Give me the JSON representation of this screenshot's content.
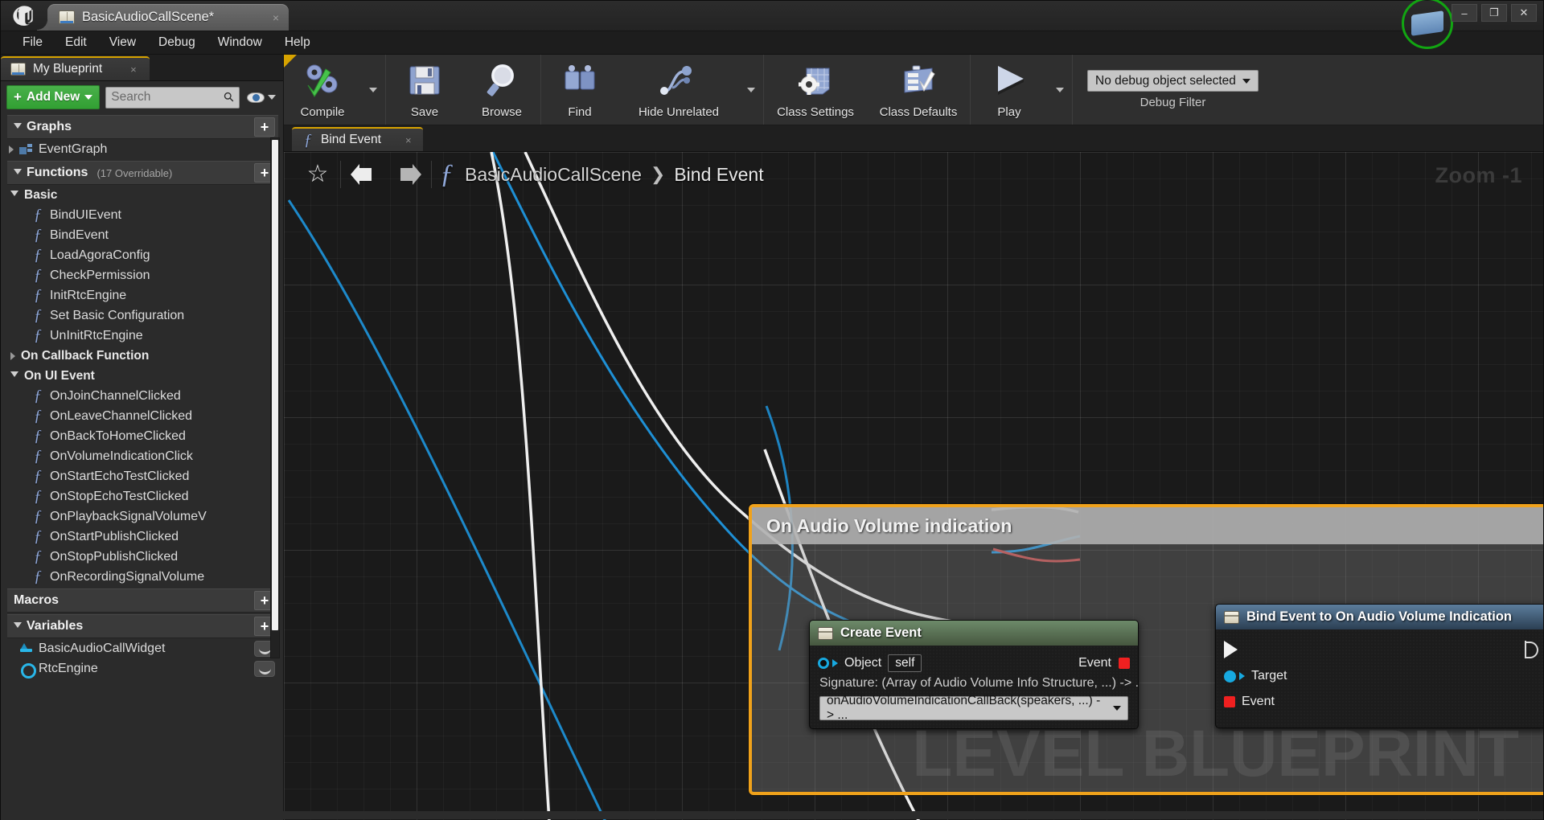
{
  "window": {
    "logo": "unreal-engine-logo",
    "document_tab": "BasicAudioCallScene*",
    "minimize": "–",
    "maximize": "❐",
    "close": "✕",
    "tab_close": "×"
  },
  "menubar": [
    "File",
    "Edit",
    "View",
    "Debug",
    "Window",
    "Help"
  ],
  "my_blueprint": {
    "tab_label": "My Blueprint",
    "tab_close": "×",
    "add_new_label": "Add New",
    "add_new_plus": "+",
    "search_placeholder": "Search",
    "sections": [
      {
        "name": "Graphs",
        "sub": "",
        "add": "+",
        "items": [
          {
            "label": "EventGraph",
            "icon": "event-graph-icon",
            "expandable": true
          }
        ]
      },
      {
        "name": "Functions",
        "sub": "(17 Overridable)",
        "add": "+",
        "categories": [
          {
            "label": "Basic",
            "expanded": true,
            "functions": [
              "BindUIEvent",
              "BindEvent",
              "LoadAgoraConfig",
              "CheckPermission",
              "InitRtcEngine",
              "Set Basic Configuration",
              "UnInitRtcEngine"
            ]
          },
          {
            "label": "On Callback Function",
            "expanded": false,
            "functions": []
          },
          {
            "label": "On UI Event",
            "expanded": true,
            "functions": [
              "OnJoinChannelClicked",
              "OnLeaveChannelClicked",
              "OnBackToHomeClicked",
              "OnVolumeIndicationClick",
              "OnStartEchoTestClicked",
              "OnStopEchoTestClicked",
              "OnPlaybackSignalVolumeV",
              "OnStartPublishClicked",
              "OnStopPublishClicked",
              "OnRecordingSignalVolume"
            ]
          }
        ]
      },
      {
        "name": "Macros",
        "sub": "",
        "add": "+",
        "items": []
      },
      {
        "name": "Variables",
        "sub": "",
        "add": "+",
        "items": [
          {
            "label": "BasicAudioCallWidget",
            "icon": "widget-variable-icon"
          },
          {
            "label": "RtcEngine",
            "icon": "object-variable-icon"
          }
        ]
      }
    ]
  },
  "toolbar": {
    "compile": "Compile",
    "save": "Save",
    "browse": "Browse",
    "find": "Find",
    "hide_unrelated": "Hide Unrelated",
    "class_settings": "Class Settings",
    "class_defaults": "Class Defaults",
    "play": "Play",
    "debug_object": "No debug object selected",
    "debug_filter_label": "Debug Filter"
  },
  "graph_tab": {
    "label": "Bind Event",
    "close": "×"
  },
  "breadcrumb": {
    "star": "☆",
    "back": "back-arrow",
    "forward": "forward-arrow",
    "fx": "ƒ",
    "root": "BasicAudioCallScene",
    "chevron": "❯",
    "current": "Bind Event"
  },
  "canvas": {
    "zoom_label": "Zoom -1",
    "watermark": "LEVEL BLUEPRINT"
  },
  "comment_node": {
    "title": "On Audio Volume indication",
    "border_color": "#f0a21b"
  },
  "create_event_node": {
    "title": "Create Event",
    "object_pin": "Object",
    "object_value": "self",
    "event_pin": "Event",
    "signature": "Signature: (Array of Audio Volume Info Structure, ...) -> ...",
    "dropdown_value": "onAudioVolumeIndicationCallBack(speakers, ...) -> ...",
    "header_color": "#5c7a58"
  },
  "bind_event_node": {
    "title": "Bind Event to On Audio Volume Indication",
    "pins": [
      "Target",
      "Event"
    ],
    "header_color": "#4e6e8c"
  }
}
